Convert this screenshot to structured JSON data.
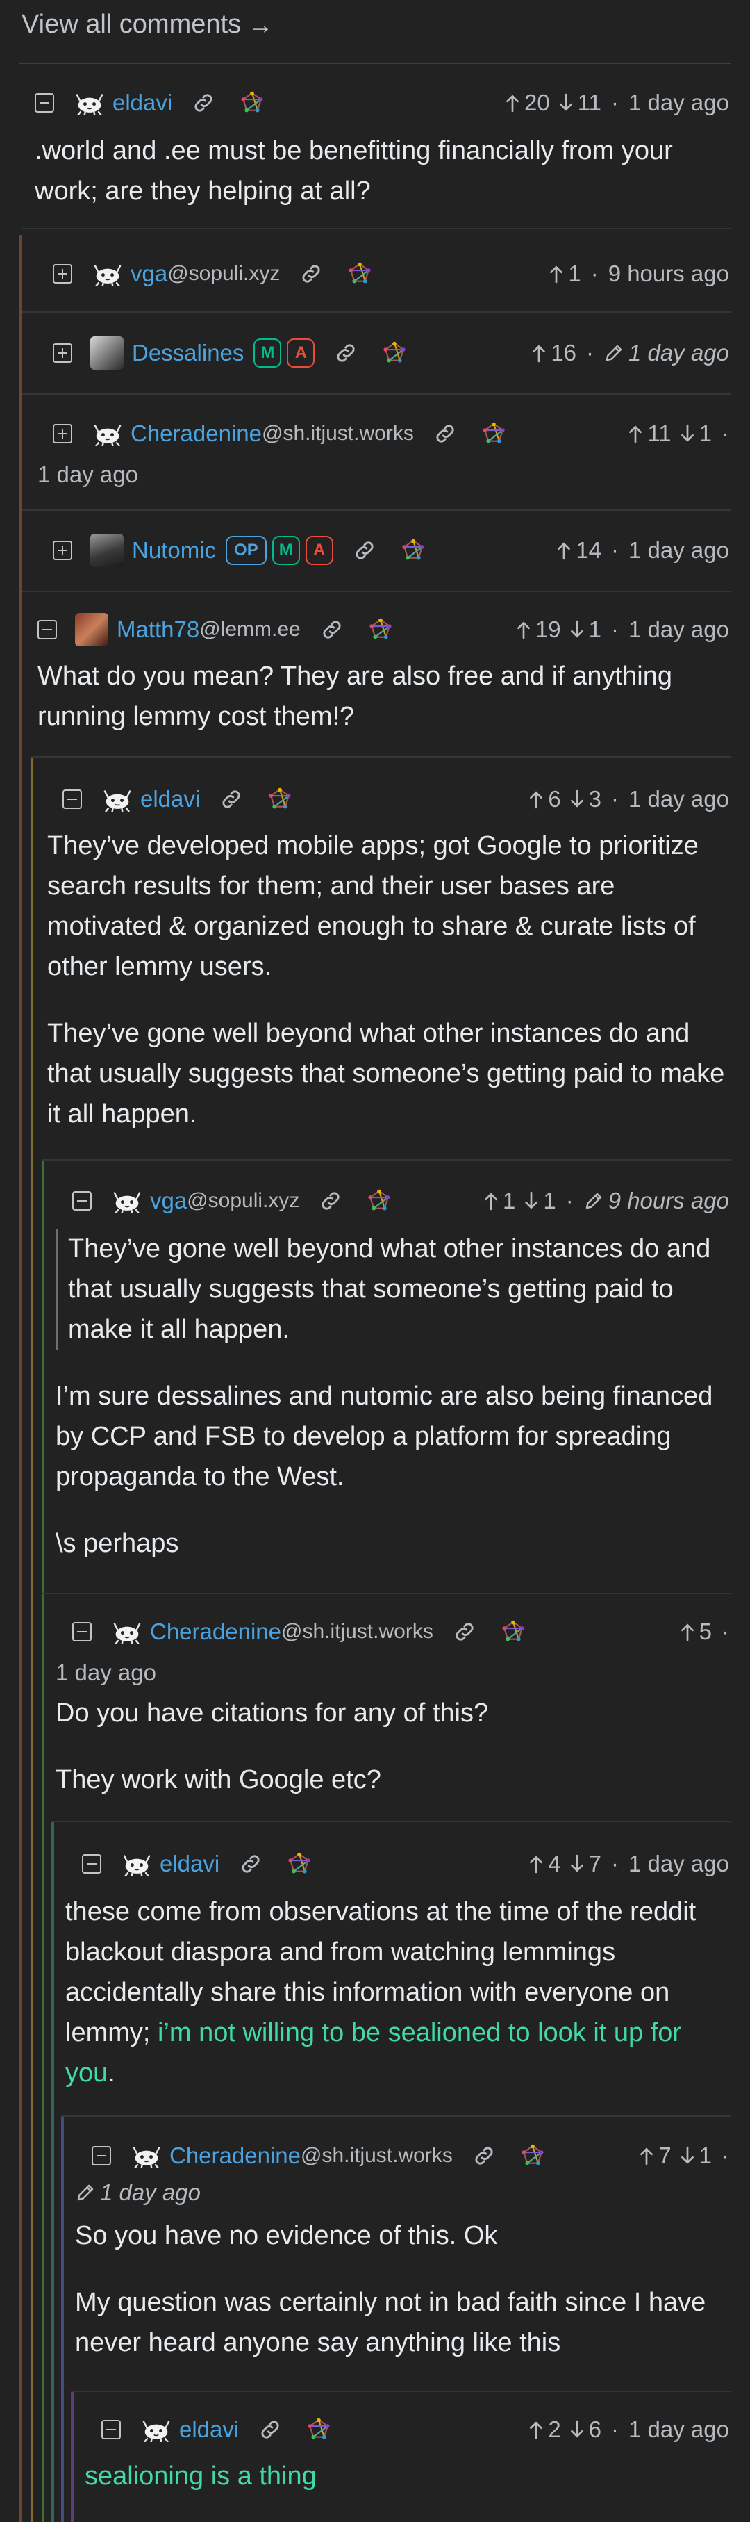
{
  "view_all_label": "View all comments",
  "view_all_arrow": "→",
  "comments": [
    {
      "user": "eldavi",
      "upvotes": "20",
      "downvotes": "11",
      "time": "1 day ago",
      "body": [
        ".world and .ee must be benefitting financially from your work; are they helping at all?"
      ]
    },
    {
      "user": "vga",
      "instance": "@sopuli.xyz",
      "upvotes": "1",
      "time": "9 hours ago"
    },
    {
      "user": "Dessalines",
      "badges": [
        "M",
        "A"
      ],
      "upvotes": "16",
      "time": "1 day ago"
    },
    {
      "user": "Cheradenine",
      "instance": "@sh.itjust.works",
      "upvotes": "11",
      "downvotes": "1",
      "time": "1 day ago"
    },
    {
      "user": "Nutomic",
      "badges": [
        "OP",
        "M",
        "A"
      ],
      "upvotes": "14",
      "time": "1 day ago"
    },
    {
      "user": "Matth78",
      "instance": "@lemm.ee",
      "upvotes": "19",
      "downvotes": "1",
      "time": "1 day ago",
      "body": [
        "What do you mean? They are also free and if anything running lemmy cost them!?"
      ]
    },
    {
      "user": "eldavi",
      "upvotes": "6",
      "downvotes": "3",
      "time": "1 day ago",
      "body": [
        "They’ve developed mobile apps; got Google to prioritize search results for them; and their user bases are motivated & organized enough to share & curate lists of other lemmy users.",
        "They’ve gone well beyond what other instances do and that usually suggests that someone’s getting paid to make it all happen."
      ]
    },
    {
      "user": "vga",
      "instance": "@sopuli.xyz",
      "upvotes": "1",
      "downvotes": "1",
      "time": "9 hours ago",
      "quote": "They’ve gone well beyond what other instances do and that usually suggests that someone’s getting paid to make it all happen.",
      "body": [
        "I’m sure dessalines and nutomic are also being financed by CCP and FSB to develop a platform for spreading propaganda to the West.",
        "\\s perhaps"
      ]
    },
    {
      "user": "Cheradenine",
      "instance": "@sh.itjust.works",
      "upvotes": "5",
      "time": "1 day ago",
      "body": [
        "Do you have citations for any of this?",
        "They work with Google etc?"
      ]
    },
    {
      "user": "eldavi",
      "upvotes": "4",
      "downvotes": "7",
      "time": "1 day ago",
      "body_plain": "these come from observations at the time of the reddit blackout diaspora and from watching lemmings accidentally share this information with everyone on lemmy; ",
      "body_green": "i’m not willing to be sealioned to look it up for you",
      "body_end": "."
    },
    {
      "user": "Cheradenine",
      "instance": "@sh.itjust.works",
      "upvotes": "7",
      "downvotes": "1",
      "time": "1 day ago",
      "body": [
        "So you have no evidence of this. Ok",
        "My question was certainly not in bad faith since I have never heard anyone say anything like this"
      ]
    },
    {
      "user": "eldavi",
      "upvotes": "2",
      "downvotes": "6",
      "time": "1 day ago",
      "body_green": "sealioning is a thing"
    }
  ],
  "colors": {
    "username": "#4aa3df",
    "badge_mod": "#00bc8c",
    "badge_admin": "#e74c3c",
    "green_text": "#41d9a4",
    "thread_lines": [
      "#7a4a2e",
      "#8a7a34",
      "#3f7a3a",
      "#2f6b5a",
      "#4a4f8a",
      "#6a3f8a"
    ]
  }
}
